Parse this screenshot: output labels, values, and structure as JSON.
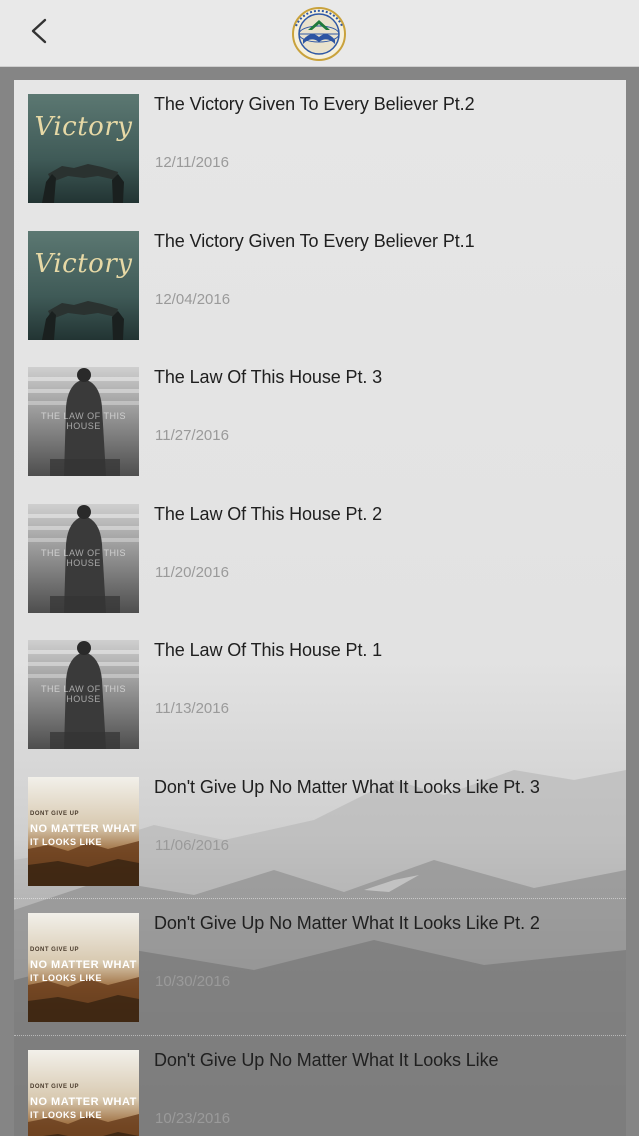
{
  "header": {
    "back_icon": "chevron-left-icon",
    "logo_icon": "church-logo-icon"
  },
  "sermons": [
    {
      "title": "The Victory Given To Every Believer Pt.2",
      "date": "12/11/2016",
      "thumb": "victory"
    },
    {
      "title": "The Victory Given To Every Believer Pt.1",
      "date": "12/04/2016",
      "thumb": "victory"
    },
    {
      "title": "The Law Of This House Pt. 3",
      "date": "11/27/2016",
      "thumb": "law"
    },
    {
      "title": "The Law Of This House Pt. 2",
      "date": "11/20/2016",
      "thumb": "law"
    },
    {
      "title": "The Law Of This House Pt. 1",
      "date": "11/13/2016",
      "thumb": "law"
    },
    {
      "title": "Don't Give Up No Matter What It Looks Like Pt. 3",
      "date": "11/06/2016",
      "thumb": "dontgiveup"
    },
    {
      "title": "Don't Give Up No Matter What It Looks Like Pt. 2",
      "date": "10/30/2016",
      "thumb": "dontgiveup"
    },
    {
      "title": "Don't Give Up No Matter What It Looks Like",
      "date": "10/23/2016",
      "thumb": "dontgiveup"
    }
  ],
  "thumb_text": {
    "victory_word": "Victory",
    "law_word": "THE LAW OF THIS HOUSE",
    "dgu_line1": "DONT GIVE UP",
    "dgu_line2": "NO MATTER WHAT",
    "dgu_line3": "IT LOOKS LIKE"
  }
}
